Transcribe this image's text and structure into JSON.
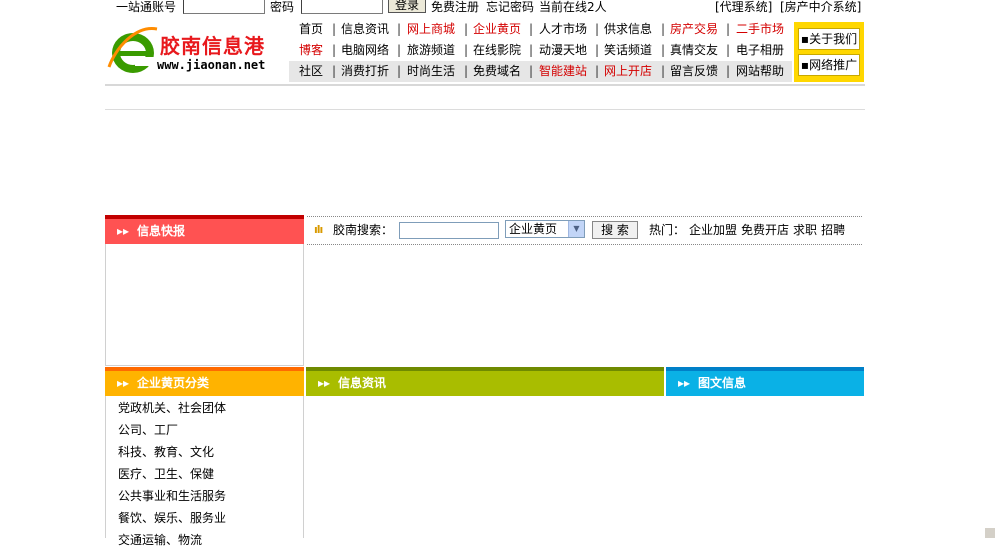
{
  "topbar": {
    "account_label": "一站通账号",
    "account_value": "",
    "password_label": "密码",
    "password_value": "",
    "login_button": "登录",
    "register_link": "免费注册",
    "forgot_link": "忘记密码",
    "online_text": "当前在线2人",
    "agent_link": "[代理系统]",
    "realestate_link": "[房产中介系统]"
  },
  "logo": {
    "cn_name": "胶南信息港",
    "domain": "www.jiaonan.net"
  },
  "nav": {
    "row1": [
      "首页",
      "信息资讯",
      "网上商城",
      "企业黄页",
      "人才市场",
      "供求信息",
      "房产交易",
      "二手市场"
    ],
    "row2": [
      "博客",
      "电脑网络",
      "旅游频道",
      "在线影院",
      "动漫天地",
      "笑话频道",
      "真情交友",
      "电子相册"
    ],
    "row3": [
      "社区",
      "消费打折",
      "时尚生活",
      "免费域名",
      "智能建站",
      "网上开店",
      "留言反馈",
      "网站帮助"
    ],
    "sep": "|",
    "red_color": "#d40000"
  },
  "side_buttons": {
    "about": "关于我们",
    "promo": "网络推广"
  },
  "news": {
    "title": "信息快报",
    "arrows": "▸▸"
  },
  "search": {
    "icon_text": "ılı",
    "label": "胶南搜索：",
    "input_value": "",
    "select_value": "企业黄页",
    "select_arrow": "▼",
    "button": "搜 索",
    "hot_label": "热门：",
    "hot_items": [
      "企业加盟",
      "免费开店",
      "求职",
      "招聘"
    ]
  },
  "categories": {
    "title": "企业黄页分类",
    "arrows": "▸▸",
    "items": [
      "党政机关、社会团体",
      "公司、工厂",
      "科技、教育、文化",
      "医疗、卫生、保健",
      "公共事业和生活服务",
      "餐饮、娱乐、服务业",
      "交通运输、物流"
    ]
  },
  "info": {
    "title": "信息资讯",
    "arrows": "▸▸"
  },
  "pics": {
    "title": "图文信息",
    "arrows": "▸▸"
  }
}
